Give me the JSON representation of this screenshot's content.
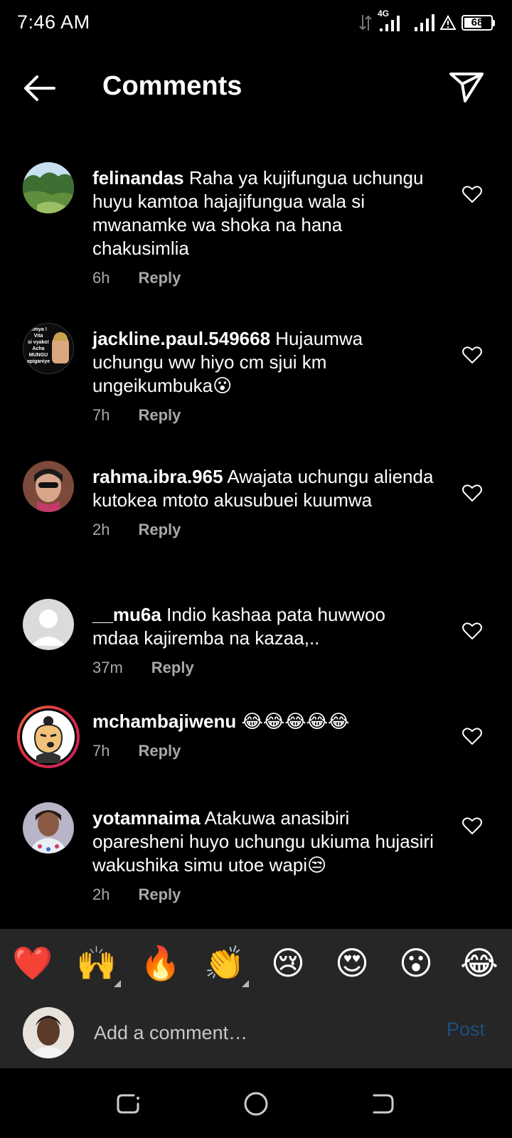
{
  "status": {
    "time": "7:46 AM",
    "network": "4G",
    "battery": "68",
    "battery_level": 0.68
  },
  "header": {
    "title": "Comments",
    "back_icon": "arrow-left-icon",
    "share_icon": "paper-plane-icon"
  },
  "comments": [
    {
      "username": "felinandas",
      "text": " Raha ya kujifungua uchungu huyu kamtoa hajajifungua wala si mwanamke wa shoka na hana chakusimlia",
      "time": "6h",
      "reply": "Reply"
    },
    {
      "username": "jackline.paul.549668",
      "text": " Hujaumwa uchungu ww hiyo cm sjui km ungeikumbuka😮",
      "time": "7h",
      "reply": "Reply",
      "avatar_text": [
        "kimya !",
        "Vita",
        "si vyako!",
        "Acha",
        "MUNGU",
        "apiganiye"
      ]
    },
    {
      "username": "rahma.ibra.965",
      "text": " Awajata uchungu alienda kutokea mtoto akusubuei kuumwa",
      "time": "2h",
      "reply": "Reply"
    },
    {
      "username": "__mu6a",
      "text": " Indio kashaa pata huwwoo mdaa kajiremba na kazaa,..",
      "time": "37m",
      "reply": "Reply"
    },
    {
      "username": "mchambajiwenu",
      "text": " 😂😂😂😂😂",
      "time": "7h",
      "reply": "Reply"
    },
    {
      "username": "yotamnaima",
      "text": " Atakuwa anasibiri oparesheni huyo uchungu ukiuma hujasiri wakushika simu utoe wapi😒",
      "time": "2h",
      "reply": "Reply"
    }
  ],
  "emoji_bar": [
    "❤️",
    "🙌",
    "🔥",
    "👏",
    "😢",
    "😍",
    "😮",
    "😂"
  ],
  "input": {
    "placeholder": "Add a comment…",
    "post_label": "Post"
  },
  "nav": {
    "recents_icon": "recents-icon",
    "home_icon": "home-circle-icon",
    "back_icon": "nav-back-icon"
  },
  "colors": {
    "background": "#000000",
    "bar": "#262626",
    "muted_text": "#a8a8a8",
    "post_disabled": "#1c4f7f"
  }
}
